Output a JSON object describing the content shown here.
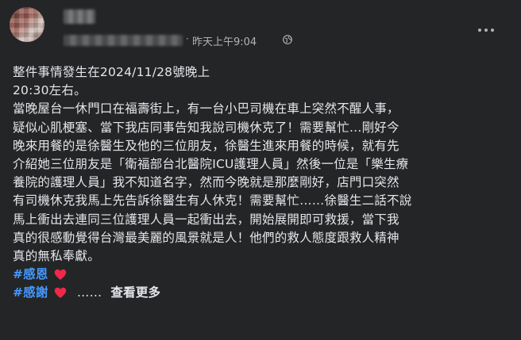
{
  "post": {
    "timestamp": "昨天上午9:04",
    "separator": "·",
    "lines": [
      "整件事情發生在2024/11/28號晚上",
      "20:30左右。",
      "當晚屋台一休門口在福壽街上，有一台小巴司機在車上突然不醒人事，",
      "疑似心肌梗塞、當下我店同事告知我說司機休克了！需要幫忙…剛好今",
      "晚來用餐的是徐醫生及他的三位朋友，徐醫生進來用餐的時候，就有先",
      "介紹她三位朋友是「衛福部台北醫院ICU護理人員」然後一位是「樂生療",
      "養院的護理人員」我不知道名字，然而今晚就是那麼剛好，店門口突然",
      "有司機休克我馬上先告訴徐醫生有人休克！需要幫忙……徐醫生二話不說",
      "馬上衝出去連同三位護理人員一起衝出去，開始展開即可救援，當下我",
      "真的很感動覺得台灣最美麗的風景就是人！他們的救人態度跟救人精神",
      "真的無私奉獻。"
    ],
    "hashtags": [
      "#感恩",
      "#感謝"
    ],
    "ellipsis": "……",
    "see_more": "查看更多"
  },
  "colors": {
    "background": "#242526",
    "text": "#e4e6eb",
    "secondary": "#b0b3b8",
    "hashtag": "#4599ff",
    "heart": "#f02849"
  },
  "icons": {
    "privacy": "globe-icon",
    "more": "more-dots-icon",
    "heart": "heart-icon"
  }
}
